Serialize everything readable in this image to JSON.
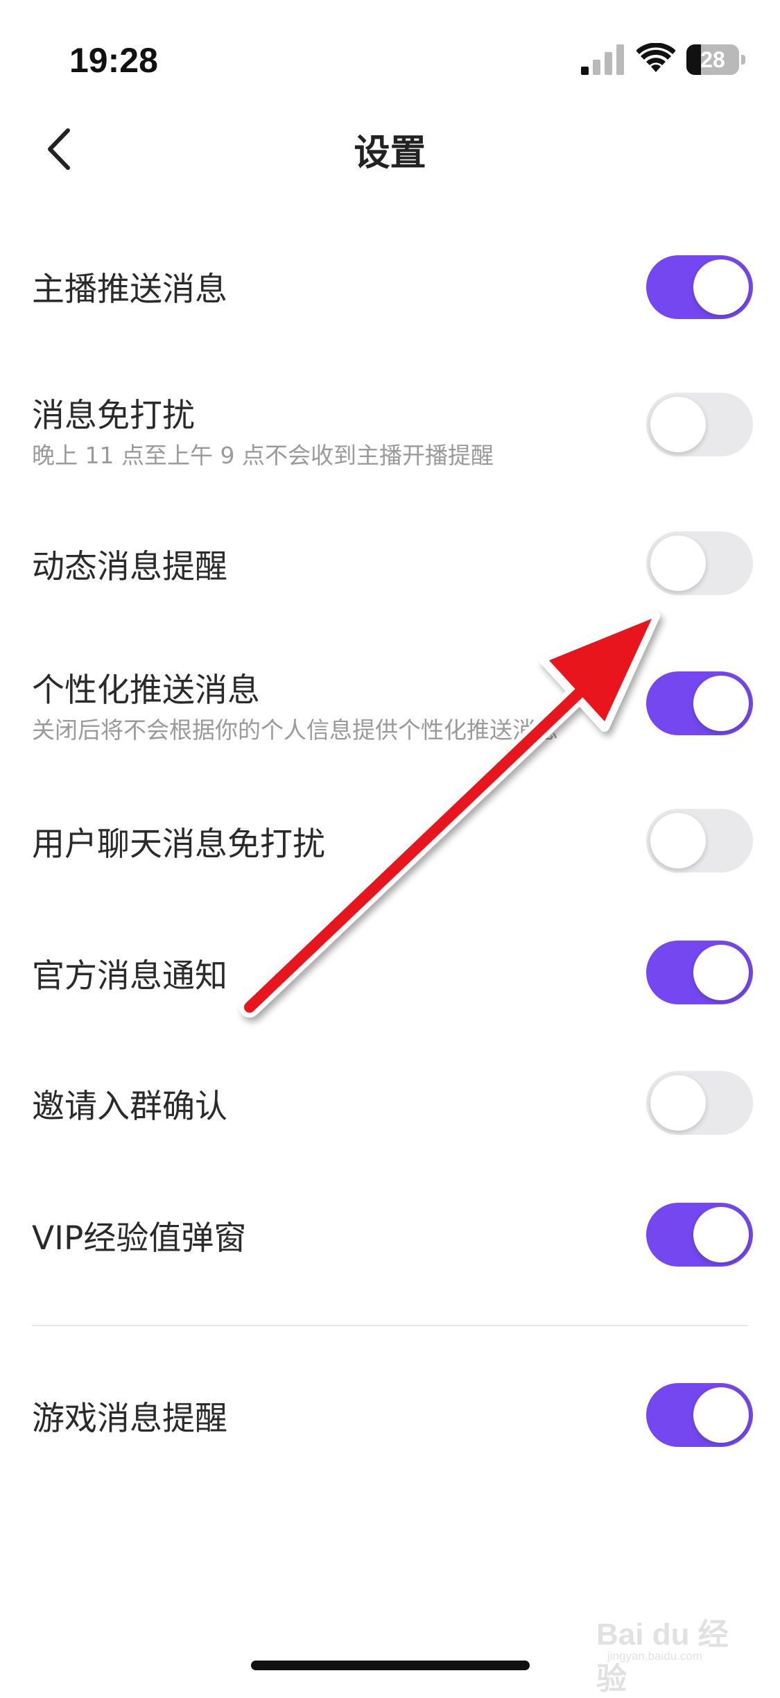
{
  "status_bar": {
    "time": "19:28",
    "battery_level": "28",
    "icons": [
      "signal-icon",
      "wifi-icon",
      "battery-icon"
    ]
  },
  "header": {
    "title": "设置",
    "back_icon": "chevron-left-icon"
  },
  "settings": [
    {
      "label": "主播推送消息",
      "description": "",
      "enabled": true
    },
    {
      "label": "消息免打扰",
      "description": "晚上 11 点至上午 9 点不会收到主播开播提醒",
      "enabled": false
    },
    {
      "label": "动态消息提醒",
      "description": "",
      "enabled": false
    },
    {
      "label": "个性化推送消息",
      "description": "关闭后将不会根据你的个人信息提供个性化推送消息",
      "enabled": true
    },
    {
      "label": "用户聊天消息免打扰",
      "description": "",
      "enabled": false
    },
    {
      "label": "官方消息通知",
      "description": "",
      "enabled": true
    },
    {
      "label": "邀请入群确认",
      "description": "",
      "enabled": false
    },
    {
      "label": "VIP经验值弹窗",
      "description": "",
      "enabled": true
    },
    {
      "label": "游戏消息提醒",
      "description": "",
      "enabled": true
    }
  ],
  "watermark": {
    "text": "Bai du 经验",
    "sub": "jingyan.baidu.com"
  },
  "colors": {
    "toggle_on": "#7447f0",
    "toggle_off": "#e9e9eb",
    "annotation_arrow": "#e8141c"
  }
}
